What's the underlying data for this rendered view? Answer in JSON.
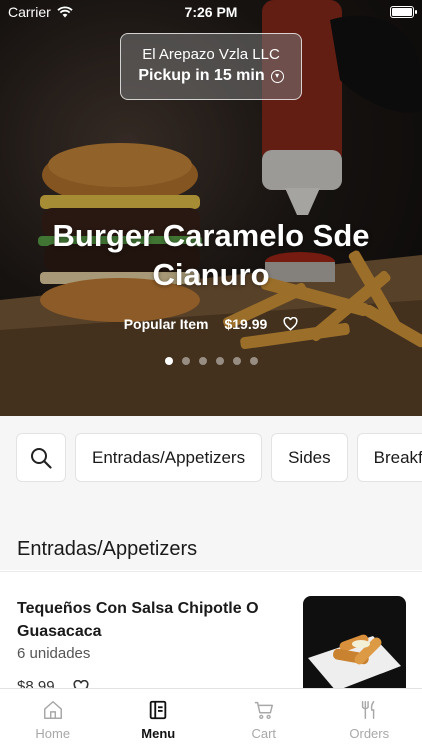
{
  "status_bar": {
    "carrier": "Carrier",
    "time": "7:26 PM"
  },
  "pickup": {
    "store_name": "El Arepazo Vzla LLC",
    "pickup_time": "Pickup in 15 min"
  },
  "hero": {
    "title": "Burger Caramelo Sde Cianuro",
    "badge": "Popular Item",
    "price": "$19.99",
    "carousel_count": 6,
    "carousel_active": 0
  },
  "categories": [
    "Entradas/Appetizers",
    "Sides",
    "Breakfast"
  ],
  "section": {
    "title": "Entradas/Appetizers"
  },
  "menu_item": {
    "name": "Tequeños Con Salsa Chipotle O Guasacaca",
    "description": "6 unidades",
    "price": "$8.99"
  },
  "tabs": [
    {
      "label": "Home",
      "icon": "home-icon",
      "active": false
    },
    {
      "label": "Menu",
      "icon": "menu-icon",
      "active": true
    },
    {
      "label": "Cart",
      "icon": "cart-icon",
      "active": false
    },
    {
      "label": "Orders",
      "icon": "orders-icon",
      "active": false
    }
  ],
  "colors": {
    "accent": "#111111",
    "inactive_tab": "#a8a8a8",
    "category_bg": "#f6f6f6"
  }
}
